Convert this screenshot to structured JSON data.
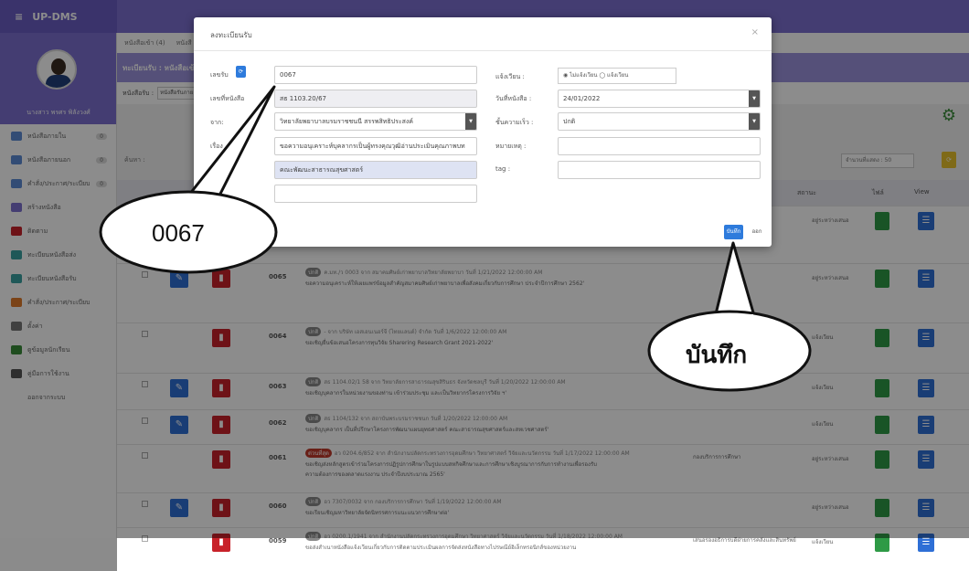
{
  "app": {
    "title": "UP-DMS",
    "menu_glyph": "≡"
  },
  "profile": {
    "name": "นางสาว พรศร พิลังวงศ์"
  },
  "sidebar": {
    "items": [
      {
        "label": "หนังสือภายใน",
        "badge": "0",
        "color": "#5b8ad6"
      },
      {
        "label": "หนังสือภายนอก",
        "badge": "0",
        "color": "#5b8ad6"
      },
      {
        "label": "คำสั่ง/ประกาศ/ระเบียบ",
        "badge": "0",
        "color": "#5b8ad6"
      },
      {
        "label": "สร้างหนังสือ",
        "badge": "",
        "color": "#7c6fd0"
      },
      {
        "label": "ติดตาม",
        "badge": "",
        "color": "#c8222a"
      },
      {
        "label": "ทะเบียนหนังสือส่ง",
        "badge": "",
        "color": "#3aa0a0"
      },
      {
        "label": "ทะเบียนหนังสือรับ",
        "badge": "",
        "color": "#3aa0a0"
      },
      {
        "label": "คำสั่ง/ประกาศ/ระเบียบ",
        "badge": "",
        "color": "#e07a2a"
      },
      {
        "label": "ตั้งค่า",
        "badge": "",
        "color": "#777"
      },
      {
        "label": "ดูข้อมูลนักเรียน",
        "badge": "",
        "color": "#3a8d3a"
      },
      {
        "label": "คู่มือการใช้งาน",
        "badge": "",
        "color": "#555"
      },
      {
        "label": "ออกจากระบบ",
        "badge": "",
        "color": "#ffffff"
      }
    ]
  },
  "main": {
    "tabs": [
      {
        "label": "หนังสือเข้า",
        "badge": "4"
      },
      {
        "label": "หนังสื"
      }
    ],
    "bar_title": "ทะเบียนรับ : หนังสือเข้า",
    "filter_label": "หนังสือรับ :",
    "filter_value": "หนังสือรับภาย",
    "search_label": "ค้นหา :",
    "rows_per_page": "จำนวนที่แสดง : 50",
    "col_status": "สถานะ",
    "col_file": "ไฟล์",
    "col_view": "View"
  },
  "rows": [
    {
      "num": "",
      "line1": "",
      "line2": "",
      "line3": "",
      "unit": "",
      "status": "อยู่ระหว่างเสนอ",
      "tag": "",
      "tag_red": false,
      "edit": true,
      "unit_extra": "ลัย"
    },
    {
      "num": "0065",
      "tag": "ปกติ",
      "tag_red": false,
      "line1": "ค.มท./ว 0003 จาก สมาคมศิษย์เก่าพยาบาลวิทยาลัยพยาบา วันที่ 1/21/2022 12:00:00 AM",
      "line2": "ขอความอนุเคราะห์ให้เผยแพร่ข้อมูลสำคัญสมาคมศิษย์เก่าพยาบาลเพื่อสังคมเกี่ยวกับการศึกษา ประจำปีการศึกษา 2562'",
      "line3": "",
      "unit": "",
      "status": "อยู่ระหว่างเสนอ",
      "edit": true
    },
    {
      "num": "0064",
      "tag": "ปกติ",
      "tag_red": false,
      "line1": "- จาก บริษัท เอสเอนเนอร์จี (ไทยแลนด์) จำกัด วันที่ 1/6/2022 12:00:00 AM",
      "line2": "ขอเชิญยื่นข้อเสนอโครงการทุนวิจัย Sharering Research Grant 2021-2022'",
      "line3": "",
      "unit": "",
      "status": "แจ้งเวียน",
      "edit": false
    },
    {
      "num": "0063",
      "tag": "ปกติ",
      "tag_red": false,
      "line1": "สธ 1104.02/1 58 จาก วิทยาลัยการสาธารณสุขสิรินธร จังหวัดชลบุรี วันที่ 1/20/2022 12:00:00 AM",
      "line2": "ขอเชิญบุคลากรในหน่วยงานของท่าน เข้าร่วมประชุม และเป็นวิทยากรโครงการวิจัย ฯ'",
      "line3": "",
      "unit": "",
      "status": "แจ้งเวียน",
      "edit": true
    },
    {
      "num": "0062",
      "tag": "ปกติ",
      "tag_red": false,
      "line1": "สธ 1104/132 จาก สถาบันพระบรมราชชนก วันที่ 1/20/2022 12:00:00 AM",
      "line2": "ขอเชิญบุคลากร เป็นที่ปรึกษาโครงการพัฒนาแผนยุทธศาสตร์ คณะสาธารณสุขศาสตร์และสหเวชศาสตร์'",
      "line3": "",
      "unit": "",
      "status": "แจ้งเวียน",
      "edit": true
    },
    {
      "num": "0061",
      "tag": "ด่วนที่สุด",
      "tag_red": true,
      "line1": "อว 0204.6/852 จาก สำนักงานปลัดกระทรวงการอุดมศึกษา วิทยาศาสตร์ วิจัยและนวัตกรรม วันที่ 1/17/2022 12:00:00 AM",
      "line2": "ขอเชิญส่งหลักสูตรเข้าร่วมโครงการปฏิรูปการศึกษาในรูปแบบสหกิจศึกษาและการศึกษาเชิงบูรณาการกับการทำงานเพื่อรองรับ",
      "line3": "ความต้องการของตลาดแรงงาน ประจำปีงบประมาณ 2565'",
      "unit": "กองบริการการศึกษา",
      "status": "อยู่ระหว่างเสนอ",
      "edit": false
    },
    {
      "num": "0060",
      "tag": "ปกติ",
      "tag_red": false,
      "line1": "อว 7307/0032 จาก กองบริการการศึกษา วันที่ 1/19/2022 12:00:00 AM",
      "line2": "ขอเรียนเชิญมหาวิทยาลัยจัดนิทรรศการแนะแนวการศึกษาต่อ'",
      "line3": "",
      "unit": "",
      "status": "อยู่ระหว่างเสนอ",
      "edit": true
    },
    {
      "num": "0059",
      "tag": "ปกติ",
      "tag_red": false,
      "line1": "อว 0200.1/1941 จาก สำนักงานปลัดกระทรวงการอุดมศึกษา วิทยาศาสตร์ วิจัยและนวัตกรรม วันที่ 1/18/2022 12:00:00 AM",
      "line2": "ขอส่งสำเนาหนังสือแจ้งเวียนเกี่ยวกับการติดตามประเมินผลการจัดส่งหนังสือทางไปรษณีย์อิเล็กทรอนิกส์ของหน่วยงาน",
      "line3": "",
      "unit": "เสนอรองอธิการบดีฝ่ายการคลังและสินทรัพย์",
      "status": "แจ้งเวียน",
      "edit": false
    }
  ],
  "modal": {
    "title": "ลงทะเบียนรับ",
    "close": "×",
    "left_labels": [
      "เลขรับ",
      "เลขที่หนังสือ",
      "จาก:",
      "เรื่อง"
    ],
    "receive_no": "0067",
    "doc_no": "สธ 1103.20/67",
    "from": "วิทยาลัยพยาบาลบรมราชชนนี สรรพสิทธิประสงค์",
    "subject": "ขอความอนุเคราะห์บุคลากรเป็นผู้ทรงคุณวุฒิอ่านประเมินคุณภาพบท",
    "subject_sub": "คณะพัฒนะสาธารณสุขศาสตร์",
    "right_labels": [
      "แจ้งเวียน :",
      "วันที่หนังสือ :",
      "ชั้นความเร็ว :",
      "หมายเหตุ :",
      "tag :"
    ],
    "circulate_radio": "◉ ไม่แจ้งเวียน ◯ แจ้งเวียน",
    "doc_date": "24/01/2022",
    "speed": "ปกติ",
    "save": "บันทึก",
    "exit": "ออก"
  },
  "callouts": {
    "left": "0067",
    "right": "บันทึก"
  }
}
